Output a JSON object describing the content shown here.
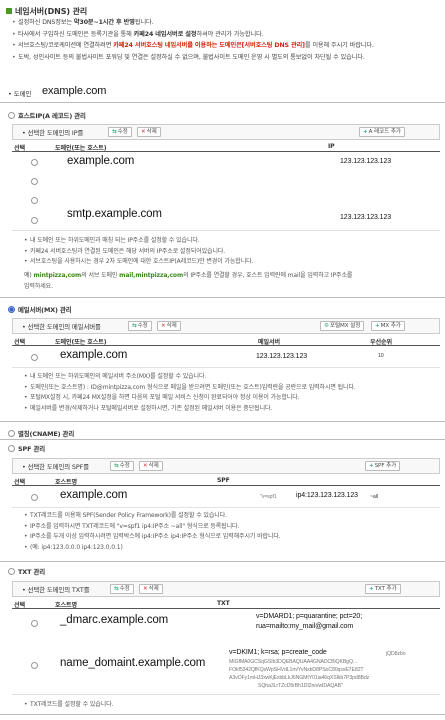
{
  "title": "네임서버(DNS) 관리",
  "notices": [
    {
      "a": "설정하신 DNS정보는 ",
      "b": "약30분~1시간 후 반영",
      "c": "됩니다."
    },
    {
      "a": "타사에서 구입하신 도메인은 등록기관을 통해 ",
      "b": "카페24 네임서버로 설정",
      "c": "하셔야 관리가 가능합니다."
    },
    {
      "a": "서브호스팅/코로케이션에 연결하려면 ",
      "r": "카페24 서버호스팅 네임서버를 이용하는 도메인은[서버호스팅 DNS 관리]",
      "c": "를 이용해 주시기 바랍니다."
    },
    {
      "a": "도박, 성인사이트 등의 불법사이트 포워딩 및 연결은 설정하실 수 없으며, 불법사이트 도메인 운영 시 별도의 통보없이 차단될 수 있습니다."
    }
  ],
  "domain_label": "도메인",
  "domain_value": "example.com",
  "a_record": {
    "section": "호스트IP(A 레코드) 관리",
    "select_label": "선택한 도메인의 IP를",
    "edit": "수정",
    "delete": "삭제",
    "add": "A 레코드 추가",
    "cols": [
      "선택",
      "도메인(또는 호스트)",
      "IP"
    ],
    "rows": [
      {
        "domain": "example.com",
        "ip": "123.123.123.123"
      },
      {
        "domain": "",
        "ip": ""
      },
      {
        "domain": "",
        "ip": ""
      },
      {
        "domain": "smtp.example.com",
        "ip": "123.123.123.123"
      }
    ],
    "info": [
      "내 도메인 또는 하위도메인과 매칭 되는 IP주소를 설정할 수 있습니다.",
      "카페24 서버호스팅과 연결된 도메인은 해당 서버의 IP주소로 설정되어있습니다.",
      "서브호스팅을 사용하시는 경우 2차 도메인에 대한 호스트IP(A레코드)만 변경이 가능합니다."
    ],
    "example_a": "예) ",
    "example_g": "mintpizza,com",
    "example_b": "의 서브 도메인 ",
    "example_g2": "mail,mintpizza,com",
    "example_c": "의 IP주소를 연결할 경우, 호스트 입력란에 mail을 입력하고 IP주소를",
    "example_d": "입력하세요."
  },
  "mx": {
    "section": "메일서버(MX) 관리",
    "select_label": "선택한 도메인의 메일서버를",
    "edit": "수정",
    "delete": "삭제",
    "extra": "포털MX 설정",
    "add": "MX 추가",
    "cols": [
      "선택",
      "도메인(또는 호스트)",
      "메일서버",
      "우선순위"
    ],
    "rows": [
      {
        "domain": "example.com",
        "server": "123.123.123.123",
        "priority": "10"
      }
    ],
    "info": [
      "내 도메인 또는 하위도메인의 메일서버 주소(MX)를 설정할 수 있습니다.",
      "도메인(또는 호스트명) : ID@mintpizza,com 형식으로 메일을 받으려면 도메인(또는 호스트)입력란을 공란으로 입력하시면 됩니다.",
      "포털MX설정 시, 카페24 MX설정을 하면 다음의 포털 메일 서비스 신청이 완료되어야 정상 이용이 가능합니다.",
      "메일서버를 변경/삭제하거나 포털메일서버로 설정하시면, 기존 설정된 메일서버 이용은 중단됩니다."
    ]
  },
  "cname": {
    "section": "별칭(CNAME) 관리"
  },
  "spf": {
    "section": "SPF 관리",
    "select_label": "선택한 도메인의 SPF를",
    "edit": "수정",
    "delete": "삭제",
    "add": "SPF 추가",
    "cols": [
      "선택",
      "호스트명",
      "SPF"
    ],
    "rows": [
      {
        "host": "example.com",
        "pre": "\"v=spf1",
        "ip": "ip4:123.123.123.123",
        "post": "~all"
      }
    ],
    "info": [
      "TXT레코드를 이용해 SPF(Sender Policy Framework)를 설정할 수 있습니다.",
      "IP주소를 입력하시면 TXT레코드에 \"v=spf1 ip4:IP주소 ~all\" 형식으로 등록됩니다.",
      "IP주소를 두개 이상 입력하시려면 입력박스에 ip4:IP주소 ip4:IP주소 형식으로 입력해주시기 바랍니다.",
      "(예: ip4:123.0.0.0 ip4:123.0.0.1)"
    ]
  },
  "txt": {
    "section": "TXT 관리",
    "select_label": "선택한 도메인의 TXT를",
    "edit": "수정",
    "delete": "삭제",
    "add": "TXT 추가",
    "cols": [
      "선택",
      "호스트명",
      "TXT"
    ],
    "rows": [
      {
        "host": "_dmarc.example.com",
        "l1": "v=DMARD1; p=quarantine; pct=20;",
        "l2": "rua=mailto:my_mail@gmail.com"
      },
      {
        "host": "name_domaint.example.com",
        "l1": "v=DKIM1; k=rsa; p=create_code",
        "l2": "MIGfMA0GCSqGSIb3DQEBAQUAA4GNADCBiQKBgQ...",
        "l3": "FOkf5342QfKQsWpSHVdL1m/YvNxbD8PSoC80qsxE7E82T",
        "l4": "A3vOFy1mHJ3xwKjExbbLkJ6NGMtY01ia46qXSIkb7P3pd8Bdz",
        "l5": "SQha3LrTZcD5rBh1DI2no/wIDAQAB\"",
        "sidecode": "jQD8zbo"
      }
    ],
    "info": [
      "TXT레코드를 설정할 수 있습니다."
    ]
  }
}
